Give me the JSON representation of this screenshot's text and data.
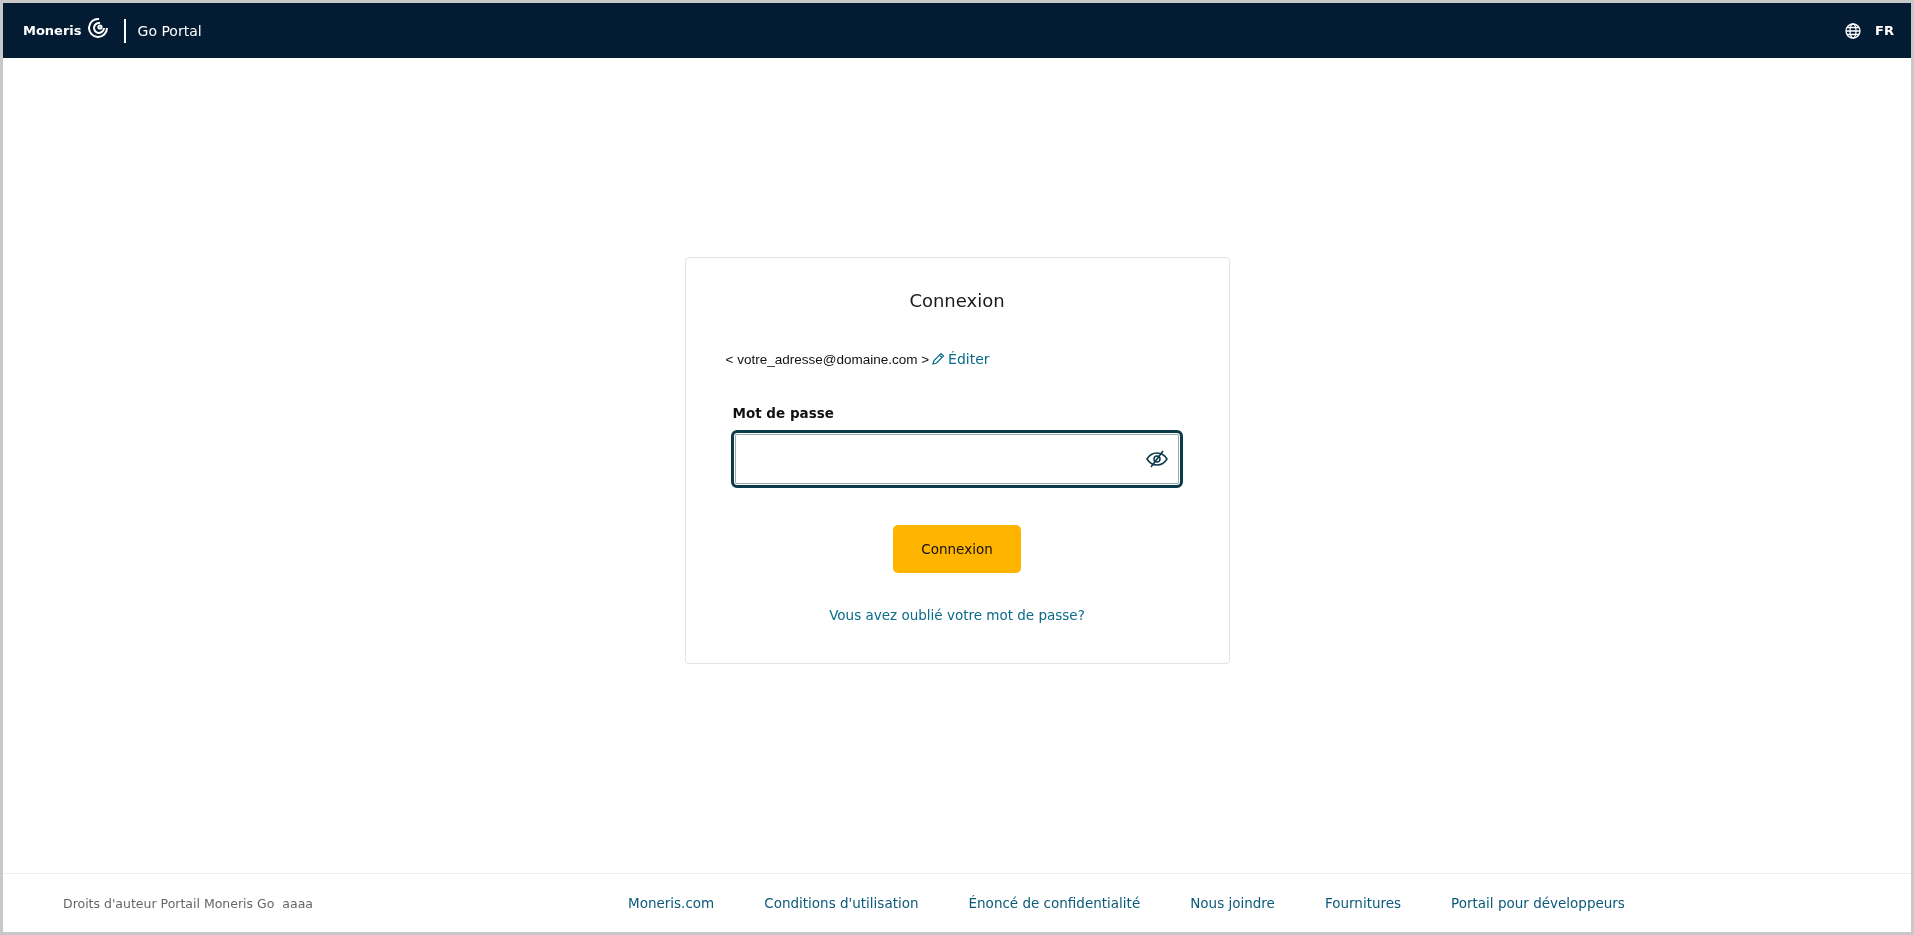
{
  "header": {
    "logo": "Moneris",
    "product": "Go Portal",
    "language": "FR"
  },
  "card": {
    "title": "Connexion",
    "email": "< votre_adresse@domaine.com >",
    "edit_link": "Éditer",
    "password": {
      "label": "Mot de passe",
      "focused": true
    },
    "submit": "Connexion",
    "forgot_link": "Vous avez oublié votre mot de passe?"
  },
  "footer": {
    "copyright": "Droits d'auteur Portail Moneris Go  aaaa",
    "links": [
      "Moneris.com",
      "Conditions d'utilisation",
      "Énoncé de confidentialité",
      "Nous joindre",
      "Fournitures",
      "Portail pour développeurs"
    ]
  }
}
